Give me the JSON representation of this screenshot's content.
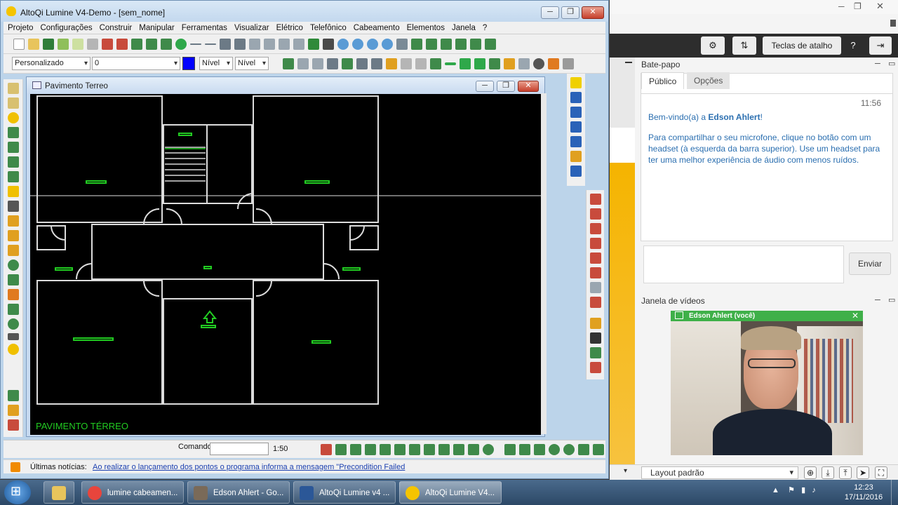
{
  "app": {
    "title": "AltoQi Lumine V4-Demo - [sem_nome]",
    "window_buttons": [
      "─",
      "❐",
      "✕"
    ]
  },
  "menu": [
    "Projeto",
    "Configurações",
    "Construir",
    "Manipular",
    "Ferramentas",
    "Visualizar",
    "Elétrico",
    "Telefônico",
    "Cabeamento",
    "Elementos",
    "Janela",
    "?"
  ],
  "toolbar2": {
    "style_combo": "Personalizado",
    "value_combo": "0",
    "color_swatch": "#0000ff",
    "level1": "Nível",
    "level2": "Nível"
  },
  "document": {
    "title": "Pavimento Terreo",
    "floor_label": "PAVIMENTO TÉRREO",
    "floor_color": "#22cc22"
  },
  "statusbar": {
    "command_label": "Comando",
    "scale": "1:50"
  },
  "news": {
    "label": "Últimas notícias:",
    "link": "Ao realizar o lançamento dos pontos o programa informa a mensagem \"Precondition Failed"
  },
  "web": {
    "shortcut_button": "Teclas de atalho",
    "help_button": "?",
    "chat_title": "Bate-papo",
    "tabs": [
      "Público",
      "Opções"
    ],
    "time": "11:56",
    "welcome_prefix": "Bem-vindo(a) a ",
    "welcome_name": "Edson Ahlert",
    "welcome_suffix": "!",
    "message": "Para compartilhar o seu microfone, clique no botão com um headset (à esquerda da barra superior). Use um headset para ter uma melhor experiência de áudio com menos ruídos.",
    "send_button": "Enviar",
    "video_title": "Janela de vídeos",
    "video_user": "Edson Ahlert (você)",
    "layout": "Layout padrão"
  },
  "taskbar": {
    "tasks": [
      {
        "label": "lumine cabeamen...",
        "color": "#e8453c"
      },
      {
        "label": "Edson Ahlert - Go...",
        "color": "#7a6a58"
      },
      {
        "label": "AltoQi Lumine v4 ...",
        "color": "#2b5797"
      },
      {
        "label": "AltoQi Lumine V4...",
        "color": "#f5c400"
      }
    ],
    "time": "12:23",
    "date": "17/11/2016"
  }
}
